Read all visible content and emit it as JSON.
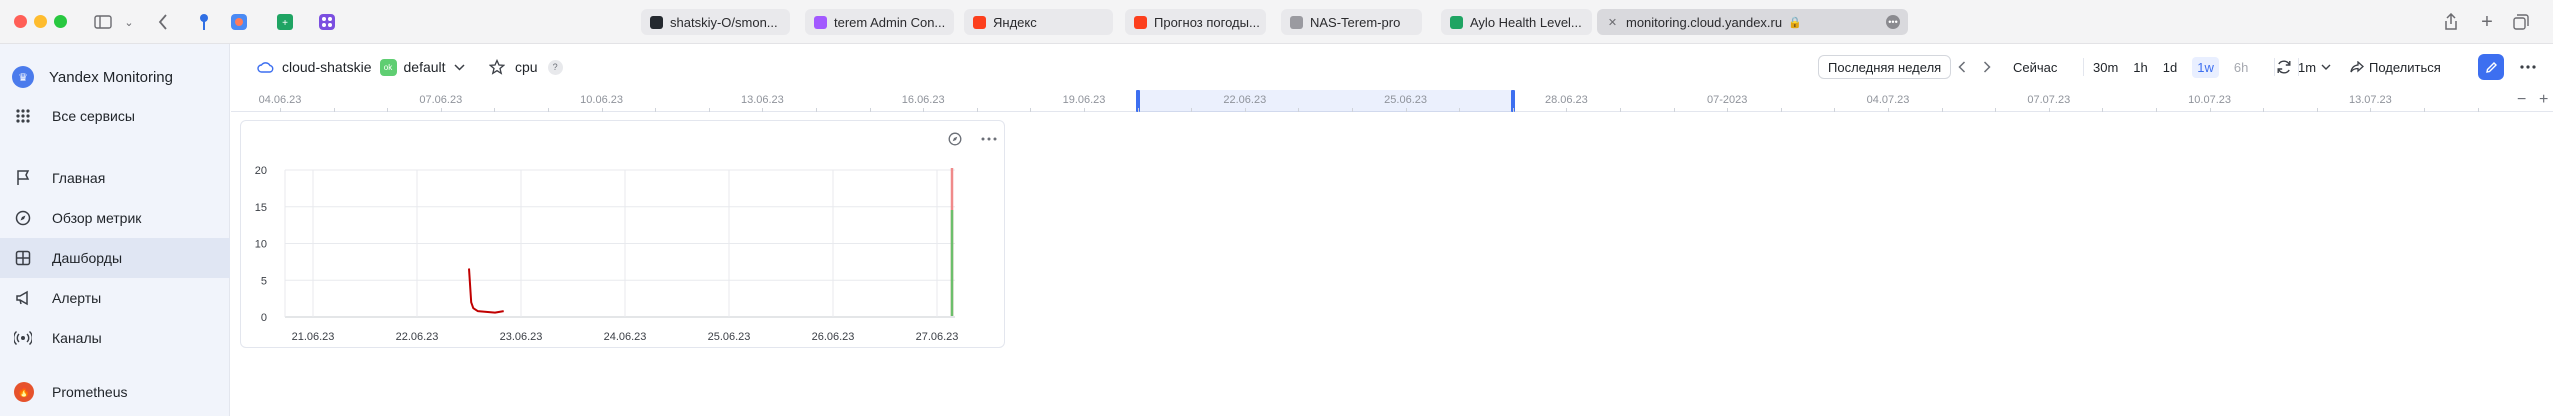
{
  "browser": {
    "tabs": [
      {
        "label": "shatskiy-O/smon...",
        "icon": "github-icon",
        "color": "#24292f"
      },
      {
        "label": "terem Admin Con...",
        "icon": "figma-icon",
        "color": "#a259ff"
      },
      {
        "label": "Яндекс",
        "icon": "yandex-icon",
        "color": "#fc3f1d"
      },
      {
        "label": "Прогноз погоды...",
        "icon": "weather-icon",
        "color": "#fc3f1d"
      },
      {
        "label": "NAS-Terem-pro",
        "icon": "nas-icon",
        "color": "#9a9aa0"
      },
      {
        "label": "Aylo Health Level...",
        "icon": "sheets-icon",
        "color": "#1fa463"
      },
      {
        "label": "monitoring.cloud.yandex.ru",
        "icon": "close-icon",
        "color": "#6b6b70",
        "active": true
      }
    ]
  },
  "sidebar": {
    "brand": "Yandex Monitoring",
    "all_services": "Все сервисы",
    "items": [
      {
        "label": "Главная",
        "icon": "flag-icon"
      },
      {
        "label": "Обзор метрик",
        "icon": "compass-icon"
      },
      {
        "label": "Дашборды",
        "icon": "dashboard-icon",
        "active": true
      },
      {
        "label": "Алерты",
        "icon": "megaphone-icon"
      },
      {
        "label": "Каналы",
        "icon": "broadcast-icon"
      }
    ],
    "prometheus": "Prometheus"
  },
  "toolbar": {
    "cloud": "cloud-shatskie",
    "folder_badge": "ok",
    "folder": "default",
    "dashboard": "cpu",
    "help": "?",
    "range": "Последняя неделя",
    "now": "Сейчас",
    "intervals": [
      {
        "label": "30m"
      },
      {
        "label": "1h"
      },
      {
        "label": "1d"
      },
      {
        "label": "1w",
        "selected": true
      },
      {
        "label": "6h",
        "disabled": true
      }
    ],
    "refresh": "1m",
    "share": "Поделиться"
  },
  "timeline": {
    "labels": [
      "04.06.23",
      "07.06.23",
      "10.06.23",
      "13.06.23",
      "16.06.23",
      "19.06.23",
      "22.06.23",
      "25.06.23",
      "28.06.23",
      "07-2023",
      "04.07.23",
      "07.07.23",
      "10.07.23",
      "13.07.23"
    ],
    "selection": [
      "20.06.23",
      "27.06.23"
    ]
  },
  "chart_data": {
    "type": "line",
    "title": "",
    "xlabel": "",
    "ylabel": "",
    "x_ticks": [
      "21.06.23",
      "22.06.23",
      "23.06.23",
      "24.06.23",
      "25.06.23",
      "26.06.23",
      "27.06.23"
    ],
    "y_ticks": [
      0,
      5,
      10,
      15,
      20
    ],
    "ylim": [
      0,
      20
    ],
    "grid": true,
    "series": [
      {
        "name": "",
        "color": "#c00000",
        "x": [
          "22.06.23 12:00",
          "22.06.23 12:30",
          "22.06.23 13:00",
          "22.06.23 14:00",
          "22.06.23 16:00",
          "22.06.23 18:00",
          "22.06.23 20:00"
        ],
        "y": [
          6.6,
          2.0,
          1.2,
          0.8,
          0.7,
          0.6,
          0.8
        ]
      }
    ]
  }
}
